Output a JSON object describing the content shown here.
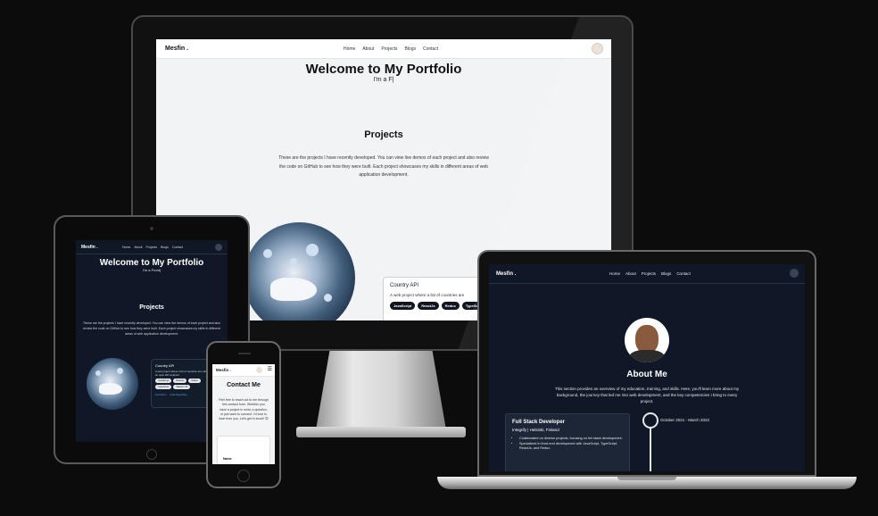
{
  "desktop": {
    "nav": {
      "logo": "Mesfin .",
      "links": [
        "Home",
        "About",
        "Projects",
        "Blogs",
        "Contact"
      ]
    },
    "hero": {
      "title": "Welcome to My Portfolio",
      "subtitle": "I'm a F|"
    },
    "projects": {
      "title": "Projects",
      "description": "These are the projects I have recently developed. You can view live demos of each project and also review the code on GitHub to see how they were built. Each project showcases my skills in different areas of web application development."
    },
    "card": {
      "title": "Country API",
      "description": "A web project where a list of countries are",
      "tags": [
        "JavaScript",
        "ReactJs",
        "Redux",
        "TypeSc"
      ]
    }
  },
  "tablet": {
    "nav": {
      "logo": "Mesfin .",
      "links": [
        "Home",
        "About",
        "Projects",
        "Blogs",
        "Contact"
      ]
    },
    "hero": {
      "title": "Welcome to My Portfolio",
      "subtitle": "I'm a Front|"
    },
    "projects": {
      "title": "Projects",
      "description": "These are the projects I have recently developed. You can view live demos of each project and also review the code on GitHub to see how they were built. Each project showcases my skills in different areas of web application development."
    },
    "card": {
      "title": "Country API",
      "description": "A web project where a list of countries are collected from an open API endpoint",
      "tags": [
        "JavaScript",
        "ReactJs",
        "Redux",
        "TypeScript",
        "Tailwind JS"
      ],
      "live_link": "Live Demo",
      "code_link": "Code Repository"
    }
  },
  "phone": {
    "nav": {
      "logo": "Mesfin .",
      "menu_icon": "menu-icon"
    },
    "contact": {
      "title": "Contact Me",
      "description": "Feel free to reach out to me through this contact form. Whether you have a project in mind, a question, or just want to connect, I'd love to hear from you. Let's get in touch! 😊"
    },
    "form": {
      "name_label": "Name"
    }
  },
  "laptop": {
    "nav": {
      "logo": "Mesfin .",
      "links": [
        "Home",
        "About",
        "Projects",
        "Blogs",
        "Contact"
      ]
    },
    "about": {
      "title": "About Me",
      "description": "This section provides an overview of my education, training, and skills. Here, you'll learn more about my background, the journey that led me into web development, and the key competencies I bring to every project."
    },
    "experience": {
      "role": "Full Stack Developer",
      "company": "Integrify | Helsinki, Finland",
      "date": "October 2021 - March 2022",
      "bullets": [
        "Collaborated on diverse projects, focusing on full stack development.",
        "Specialized in front-end development with JavaScript, TypeScript, ReactJs, and Redux."
      ]
    }
  },
  "colors": {
    "background": "#0c0c0c",
    "dark_theme": "#101828",
    "light_theme": "#f2f3f5",
    "tag_dark": "#0f1620",
    "link_blue": "#60a5fa"
  }
}
